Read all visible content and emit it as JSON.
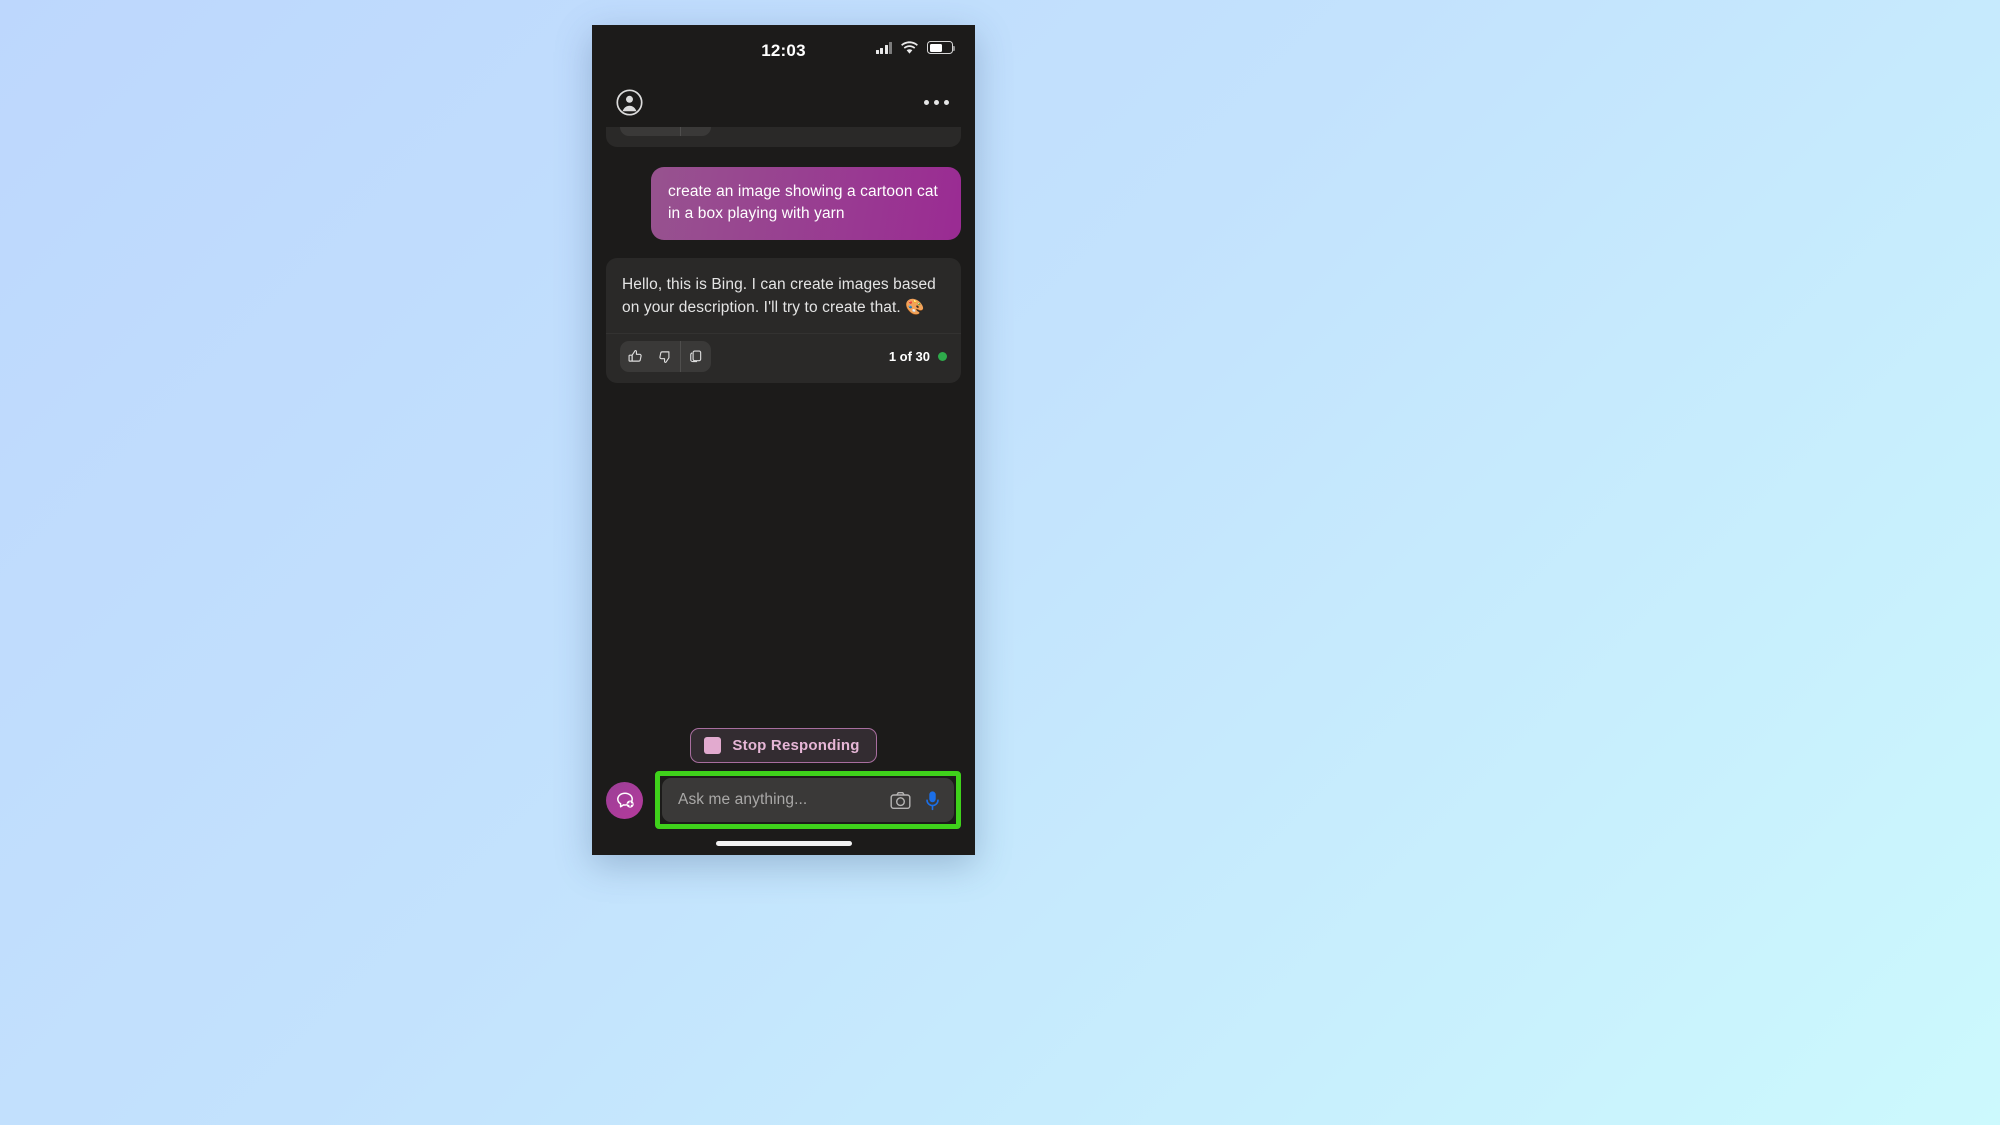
{
  "status_bar": {
    "time": "12:03",
    "signal_icon": "cellular-signal-icon",
    "wifi_icon": "wifi-icon",
    "battery_icon": "battery-icon"
  },
  "app_header": {
    "account_icon": "account-circle-icon",
    "overflow_menu_icon": "more-options-icon"
  },
  "conversation": {
    "clipped_message": {
      "reactions": {
        "thumbs_up": "thumbs-up-icon",
        "thumbs_down": "thumbs-down-icon",
        "copy": "copy-icon"
      }
    },
    "user_message": {
      "text": "create an image showing a cartoon cat in a box playing with yarn",
      "bubble_gradient_from": "#97538f",
      "bubble_gradient_to": "#9a2b93"
    },
    "assistant_message": {
      "text": "Hello, this is Bing. I can create images based on your description. I'll try to create that. 🎨",
      "reactions": {
        "thumbs_up": "thumbs-up-icon",
        "thumbs_down": "thumbs-down-icon",
        "copy": "copy-icon"
      },
      "counter": "1 of 30",
      "status_dot_color": "#2eaa4b"
    }
  },
  "stop_responding": {
    "label": "Stop Responding",
    "icon": "stop-square-icon",
    "accent_color": "#e6b6d6"
  },
  "composer": {
    "new_chat_icon": "new-chat-bubble-icon",
    "placeholder": "Ask me anything...",
    "camera_icon": "camera-icon",
    "microphone_icon": "microphone-icon",
    "highlight_color": "#3fd21b"
  },
  "home_indicator": "home-indicator"
}
